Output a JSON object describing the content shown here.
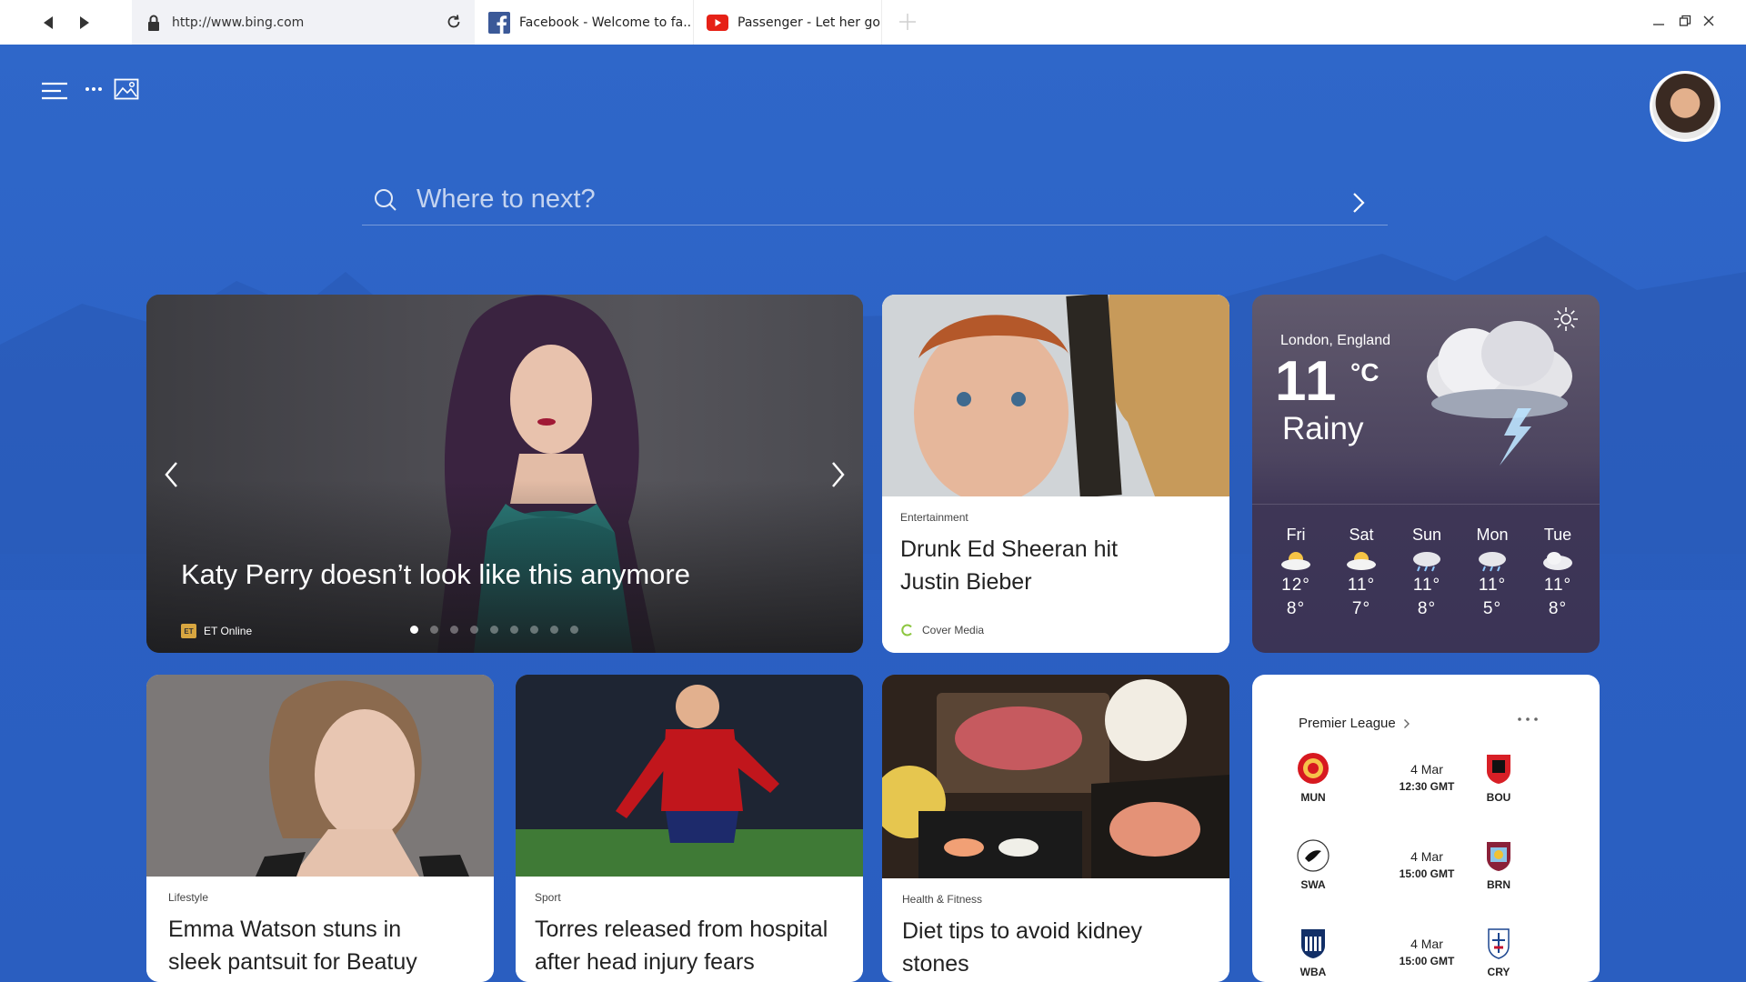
{
  "browser": {
    "url": "http://www.bing.com",
    "tabs": [
      {
        "label": "Facebook - Welcome to fa.."
      },
      {
        "label": "Passenger - Let her go"
      }
    ]
  },
  "search": {
    "placeholder": "Where to next?"
  },
  "hero": {
    "title": "Katy Perry doesn’t look like this anymore",
    "source": "ET Online",
    "source_badge": "ET",
    "slide_count": 9,
    "active_slide": 1
  },
  "story_ed": {
    "category": "Entertainment",
    "headline": "Drunk Ed Sheeran hit Justin Bieber",
    "source": "Cover Media"
  },
  "weather": {
    "location": "London, England",
    "temp": "11",
    "unit": "°C",
    "condition": "Rainy",
    "forecast": [
      {
        "day": "Fri",
        "hi": "12°",
        "lo": "8°",
        "icon": "partly-sunny-icon"
      },
      {
        "day": "Sat",
        "hi": "11°",
        "lo": "7°",
        "icon": "partly-sunny-icon"
      },
      {
        "day": "Sun",
        "hi": "11°",
        "lo": "8°",
        "icon": "rain-cloud-icon"
      },
      {
        "day": "Mon",
        "hi": "11°",
        "lo": "5°",
        "icon": "rain-cloud-icon"
      },
      {
        "day": "Tue",
        "hi": "11°",
        "lo": "8°",
        "icon": "cloud-icon"
      }
    ]
  },
  "story_emma": {
    "category": "Lifestyle",
    "headline": "Emma Watson stuns in sleek pantsuit for Beatuy and the"
  },
  "story_torres": {
    "category": "Sport",
    "headline": "Torres released from hospital after head injury fears"
  },
  "story_diet": {
    "category": "Health & Fitness",
    "headline": "Diet tips to avoid kidney stones"
  },
  "league": {
    "title": "Premier League",
    "matches": [
      {
        "home": "MUN",
        "away": "BOU",
        "date": "4 Mar",
        "time": "12:30 GMT"
      },
      {
        "home": "SWA",
        "away": "BRN",
        "date": "4 Mar",
        "time": "15:00 GMT"
      },
      {
        "home": "WBA",
        "away": "CRY",
        "date": "4 Mar",
        "time": "15:00 GMT"
      }
    ]
  },
  "colors": {
    "background": "#2c64c8",
    "accent_green": "#8cc63f",
    "youtube_red": "#e62117",
    "facebook_blue": "#3b5998"
  }
}
